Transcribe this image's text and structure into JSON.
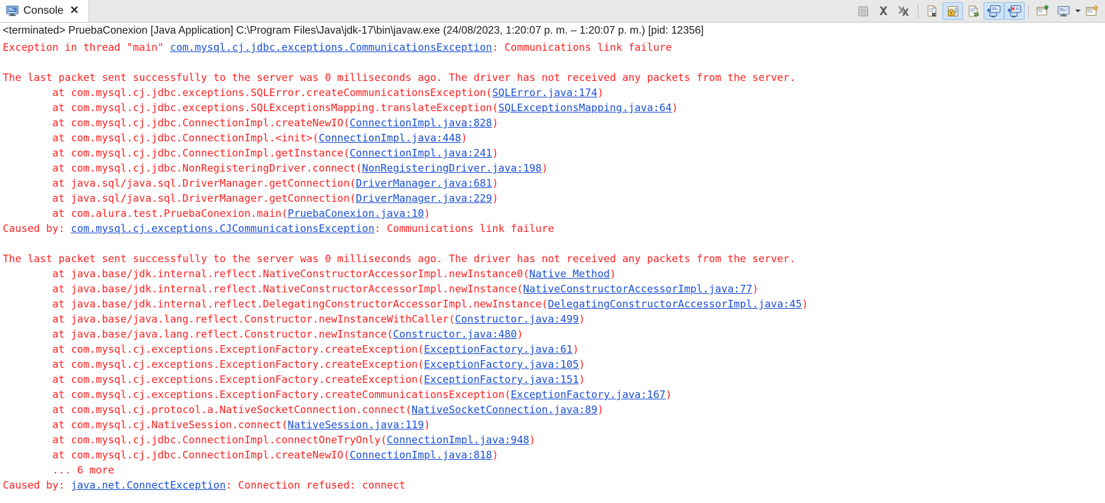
{
  "window": {
    "tab": {
      "label": "Console",
      "close_label": "✕",
      "icon": "console-icon"
    }
  },
  "toolbar": {
    "buttons": [
      {
        "name": "terminate-button",
        "icon": "stop-square-icon",
        "state": "disabled",
        "tooltip": "Terminate"
      },
      {
        "name": "remove-launch-button",
        "icon": "remove-x-icon",
        "state": "enabled",
        "tooltip": "Remove Launch"
      },
      {
        "name": "remove-all-terminated-button",
        "icon": "remove-all-xx-icon",
        "state": "enabled",
        "tooltip": "Remove All Terminated Launches"
      },
      {
        "name": "separator-1",
        "icon": "separator",
        "state": "static"
      },
      {
        "name": "clear-console-button",
        "icon": "clear-console-icon",
        "state": "enabled",
        "tooltip": "Clear Console"
      },
      {
        "name": "scroll-lock-button",
        "icon": "scroll-lock-icon",
        "state": "active",
        "tooltip": "Scroll Lock"
      },
      {
        "name": "word-wrap-button",
        "icon": "word-wrap-icon",
        "state": "enabled",
        "tooltip": "Word Wrap"
      },
      {
        "name": "show-console-on-output-button",
        "icon": "show-console-output-icon",
        "state": "active",
        "tooltip": "Show Console When Standard Out Changes"
      },
      {
        "name": "show-console-on-error-button",
        "icon": "show-console-error-icon",
        "state": "active",
        "tooltip": "Show Console When Standard Error Changes"
      },
      {
        "name": "separator-2",
        "icon": "separator",
        "state": "static"
      },
      {
        "name": "pin-console-button",
        "icon": "pin-console-icon",
        "state": "enabled",
        "tooltip": "Pin Console"
      },
      {
        "name": "display-selected-console-button",
        "icon": "display-selected-console-icon",
        "state": "enabled",
        "tooltip": "Display Selected Console"
      },
      {
        "name": "display-selected-console-caret",
        "icon": "chevron-down-icon",
        "state": "enabled",
        "tooltip": "Display Selected Console Menu"
      },
      {
        "name": "open-console-button",
        "icon": "open-console-icon",
        "state": "enabled",
        "tooltip": "Open Console"
      }
    ]
  },
  "process": {
    "description": "<terminated> PruebaConexion [Java Application] C:\\Program Files\\Java\\jdk-17\\bin\\javaw.exe  (24/08/2023, 1:20:07 p. m. – 1:20:07 p. m.) [pid: 12356]"
  },
  "colors": {
    "error_text": "#ff2020",
    "hyperlink": "#1a4fd6",
    "toolbar_active": "#cfe3f7",
    "tabbar_background": "#e8e8e8",
    "console_background": "#ffffff"
  },
  "console": {
    "lines": [
      {
        "type": "mixed",
        "parts": [
          {
            "t": "Exception in thread \"main\" ",
            "k": "err"
          },
          {
            "t": "com.mysql.cj.jdbc.exceptions.CommunicationsException",
            "k": "lnk"
          },
          {
            "t": ": Communications link failure",
            "k": "err"
          }
        ]
      },
      {
        "type": "blank",
        "parts": []
      },
      {
        "type": "mixed",
        "parts": [
          {
            "t": "The last packet sent successfully to the server was 0 milliseconds ago. The driver has not received any packets from the server.",
            "k": "err"
          }
        ]
      },
      {
        "type": "mixed",
        "parts": [
          {
            "t": "\tat com.mysql.cj.jdbc.exceptions.SQLError.createCommunicationsException(",
            "k": "err"
          },
          {
            "t": "SQLError.java:174",
            "k": "lnk"
          },
          {
            "t": ")",
            "k": "err"
          }
        ]
      },
      {
        "type": "mixed",
        "parts": [
          {
            "t": "\tat com.mysql.cj.jdbc.exceptions.SQLExceptionsMapping.translateException(",
            "k": "err"
          },
          {
            "t": "SQLExceptionsMapping.java:64",
            "k": "lnk"
          },
          {
            "t": ")",
            "k": "err"
          }
        ]
      },
      {
        "type": "mixed",
        "parts": [
          {
            "t": "\tat com.mysql.cj.jdbc.ConnectionImpl.createNewIO(",
            "k": "err"
          },
          {
            "t": "ConnectionImpl.java:828",
            "k": "lnk"
          },
          {
            "t": ")",
            "k": "err"
          }
        ]
      },
      {
        "type": "mixed",
        "parts": [
          {
            "t": "\tat com.mysql.cj.jdbc.ConnectionImpl.<init>(",
            "k": "err"
          },
          {
            "t": "ConnectionImpl.java:448",
            "k": "lnk"
          },
          {
            "t": ")",
            "k": "err"
          }
        ]
      },
      {
        "type": "mixed",
        "parts": [
          {
            "t": "\tat com.mysql.cj.jdbc.ConnectionImpl.getInstance(",
            "k": "err"
          },
          {
            "t": "ConnectionImpl.java:241",
            "k": "lnk"
          },
          {
            "t": ")",
            "k": "err"
          }
        ]
      },
      {
        "type": "mixed",
        "parts": [
          {
            "t": "\tat com.mysql.cj.jdbc.NonRegisteringDriver.connect(",
            "k": "err"
          },
          {
            "t": "NonRegisteringDriver.java:198",
            "k": "lnk"
          },
          {
            "t": ")",
            "k": "err"
          }
        ]
      },
      {
        "type": "mixed",
        "parts": [
          {
            "t": "\tat java.sql/java.sql.DriverManager.getConnection(",
            "k": "err"
          },
          {
            "t": "DriverManager.java:681",
            "k": "lnk"
          },
          {
            "t": ")",
            "k": "err"
          }
        ]
      },
      {
        "type": "mixed",
        "parts": [
          {
            "t": "\tat java.sql/java.sql.DriverManager.getConnection(",
            "k": "err"
          },
          {
            "t": "DriverManager.java:229",
            "k": "lnk"
          },
          {
            "t": ")",
            "k": "err"
          }
        ]
      },
      {
        "type": "mixed",
        "parts": [
          {
            "t": "\tat com.alura.test.PruebaConexion.main(",
            "k": "err"
          },
          {
            "t": "PruebaConexion.java:10",
            "k": "lnk"
          },
          {
            "t": ")",
            "k": "err"
          }
        ]
      },
      {
        "type": "mixed",
        "parts": [
          {
            "t": "Caused by: ",
            "k": "err"
          },
          {
            "t": "com.mysql.cj.exceptions.CJCommunicationsException",
            "k": "lnk"
          },
          {
            "t": ": Communications link failure",
            "k": "err"
          }
        ]
      },
      {
        "type": "blank",
        "parts": []
      },
      {
        "type": "mixed",
        "parts": [
          {
            "t": "The last packet sent successfully to the server was 0 milliseconds ago. The driver has not received any packets from the server.",
            "k": "err"
          }
        ]
      },
      {
        "type": "mixed",
        "parts": [
          {
            "t": "\tat java.base/jdk.internal.reflect.NativeConstructorAccessorImpl.newInstance0(",
            "k": "err"
          },
          {
            "t": "Native Method",
            "k": "lnk"
          },
          {
            "t": ")",
            "k": "err"
          }
        ]
      },
      {
        "type": "mixed",
        "parts": [
          {
            "t": "\tat java.base/jdk.internal.reflect.NativeConstructorAccessorImpl.newInstance(",
            "k": "err"
          },
          {
            "t": "NativeConstructorAccessorImpl.java:77",
            "k": "lnk"
          },
          {
            "t": ")",
            "k": "err"
          }
        ]
      },
      {
        "type": "mixed",
        "parts": [
          {
            "t": "\tat java.base/jdk.internal.reflect.DelegatingConstructorAccessorImpl.newInstance(",
            "k": "err"
          },
          {
            "t": "DelegatingConstructorAccessorImpl.java:45",
            "k": "lnk"
          },
          {
            "t": ")",
            "k": "err"
          }
        ]
      },
      {
        "type": "mixed",
        "parts": [
          {
            "t": "\tat java.base/java.lang.reflect.Constructor.newInstanceWithCaller(",
            "k": "err"
          },
          {
            "t": "Constructor.java:499",
            "k": "lnk"
          },
          {
            "t": ")",
            "k": "err"
          }
        ]
      },
      {
        "type": "mixed",
        "parts": [
          {
            "t": "\tat java.base/java.lang.reflect.Constructor.newInstance(",
            "k": "err"
          },
          {
            "t": "Constructor.java:480",
            "k": "lnk"
          },
          {
            "t": ")",
            "k": "err"
          }
        ]
      },
      {
        "type": "mixed",
        "parts": [
          {
            "t": "\tat com.mysql.cj.exceptions.ExceptionFactory.createException(",
            "k": "err"
          },
          {
            "t": "ExceptionFactory.java:61",
            "k": "lnk"
          },
          {
            "t": ")",
            "k": "err"
          }
        ]
      },
      {
        "type": "mixed",
        "parts": [
          {
            "t": "\tat com.mysql.cj.exceptions.ExceptionFactory.createException(",
            "k": "err"
          },
          {
            "t": "ExceptionFactory.java:105",
            "k": "lnk"
          },
          {
            "t": ")",
            "k": "err"
          }
        ]
      },
      {
        "type": "mixed",
        "parts": [
          {
            "t": "\tat com.mysql.cj.exceptions.ExceptionFactory.createException(",
            "k": "err"
          },
          {
            "t": "ExceptionFactory.java:151",
            "k": "lnk"
          },
          {
            "t": ")",
            "k": "err"
          }
        ]
      },
      {
        "type": "mixed",
        "parts": [
          {
            "t": "\tat com.mysql.cj.exceptions.ExceptionFactory.createCommunicationsException(",
            "k": "err"
          },
          {
            "t": "ExceptionFactory.java:167",
            "k": "lnk"
          },
          {
            "t": ")",
            "k": "err"
          }
        ]
      },
      {
        "type": "mixed",
        "parts": [
          {
            "t": "\tat com.mysql.cj.protocol.a.NativeSocketConnection.connect(",
            "k": "err"
          },
          {
            "t": "NativeSocketConnection.java:89",
            "k": "lnk"
          },
          {
            "t": ")",
            "k": "err"
          }
        ]
      },
      {
        "type": "mixed",
        "parts": [
          {
            "t": "\tat com.mysql.cj.NativeSession.connect(",
            "k": "err"
          },
          {
            "t": "NativeSession.java:119",
            "k": "lnk"
          },
          {
            "t": ")",
            "k": "err"
          }
        ]
      },
      {
        "type": "mixed",
        "parts": [
          {
            "t": "\tat com.mysql.cj.jdbc.ConnectionImpl.connectOneTryOnly(",
            "k": "err"
          },
          {
            "t": "ConnectionImpl.java:948",
            "k": "lnk"
          },
          {
            "t": ")",
            "k": "err"
          }
        ]
      },
      {
        "type": "mixed",
        "parts": [
          {
            "t": "\tat com.mysql.cj.jdbc.ConnectionImpl.createNewIO(",
            "k": "err"
          },
          {
            "t": "ConnectionImpl.java:818",
            "k": "lnk"
          },
          {
            "t": ")",
            "k": "err"
          }
        ]
      },
      {
        "type": "mixed",
        "parts": [
          {
            "t": "\t... 6 more",
            "k": "err"
          }
        ]
      },
      {
        "type": "mixed",
        "parts": [
          {
            "t": "Caused by: ",
            "k": "err"
          },
          {
            "t": "java.net.ConnectException",
            "k": "lnk"
          },
          {
            "t": ": Connection refused: connect",
            "k": "err"
          }
        ]
      }
    ]
  }
}
